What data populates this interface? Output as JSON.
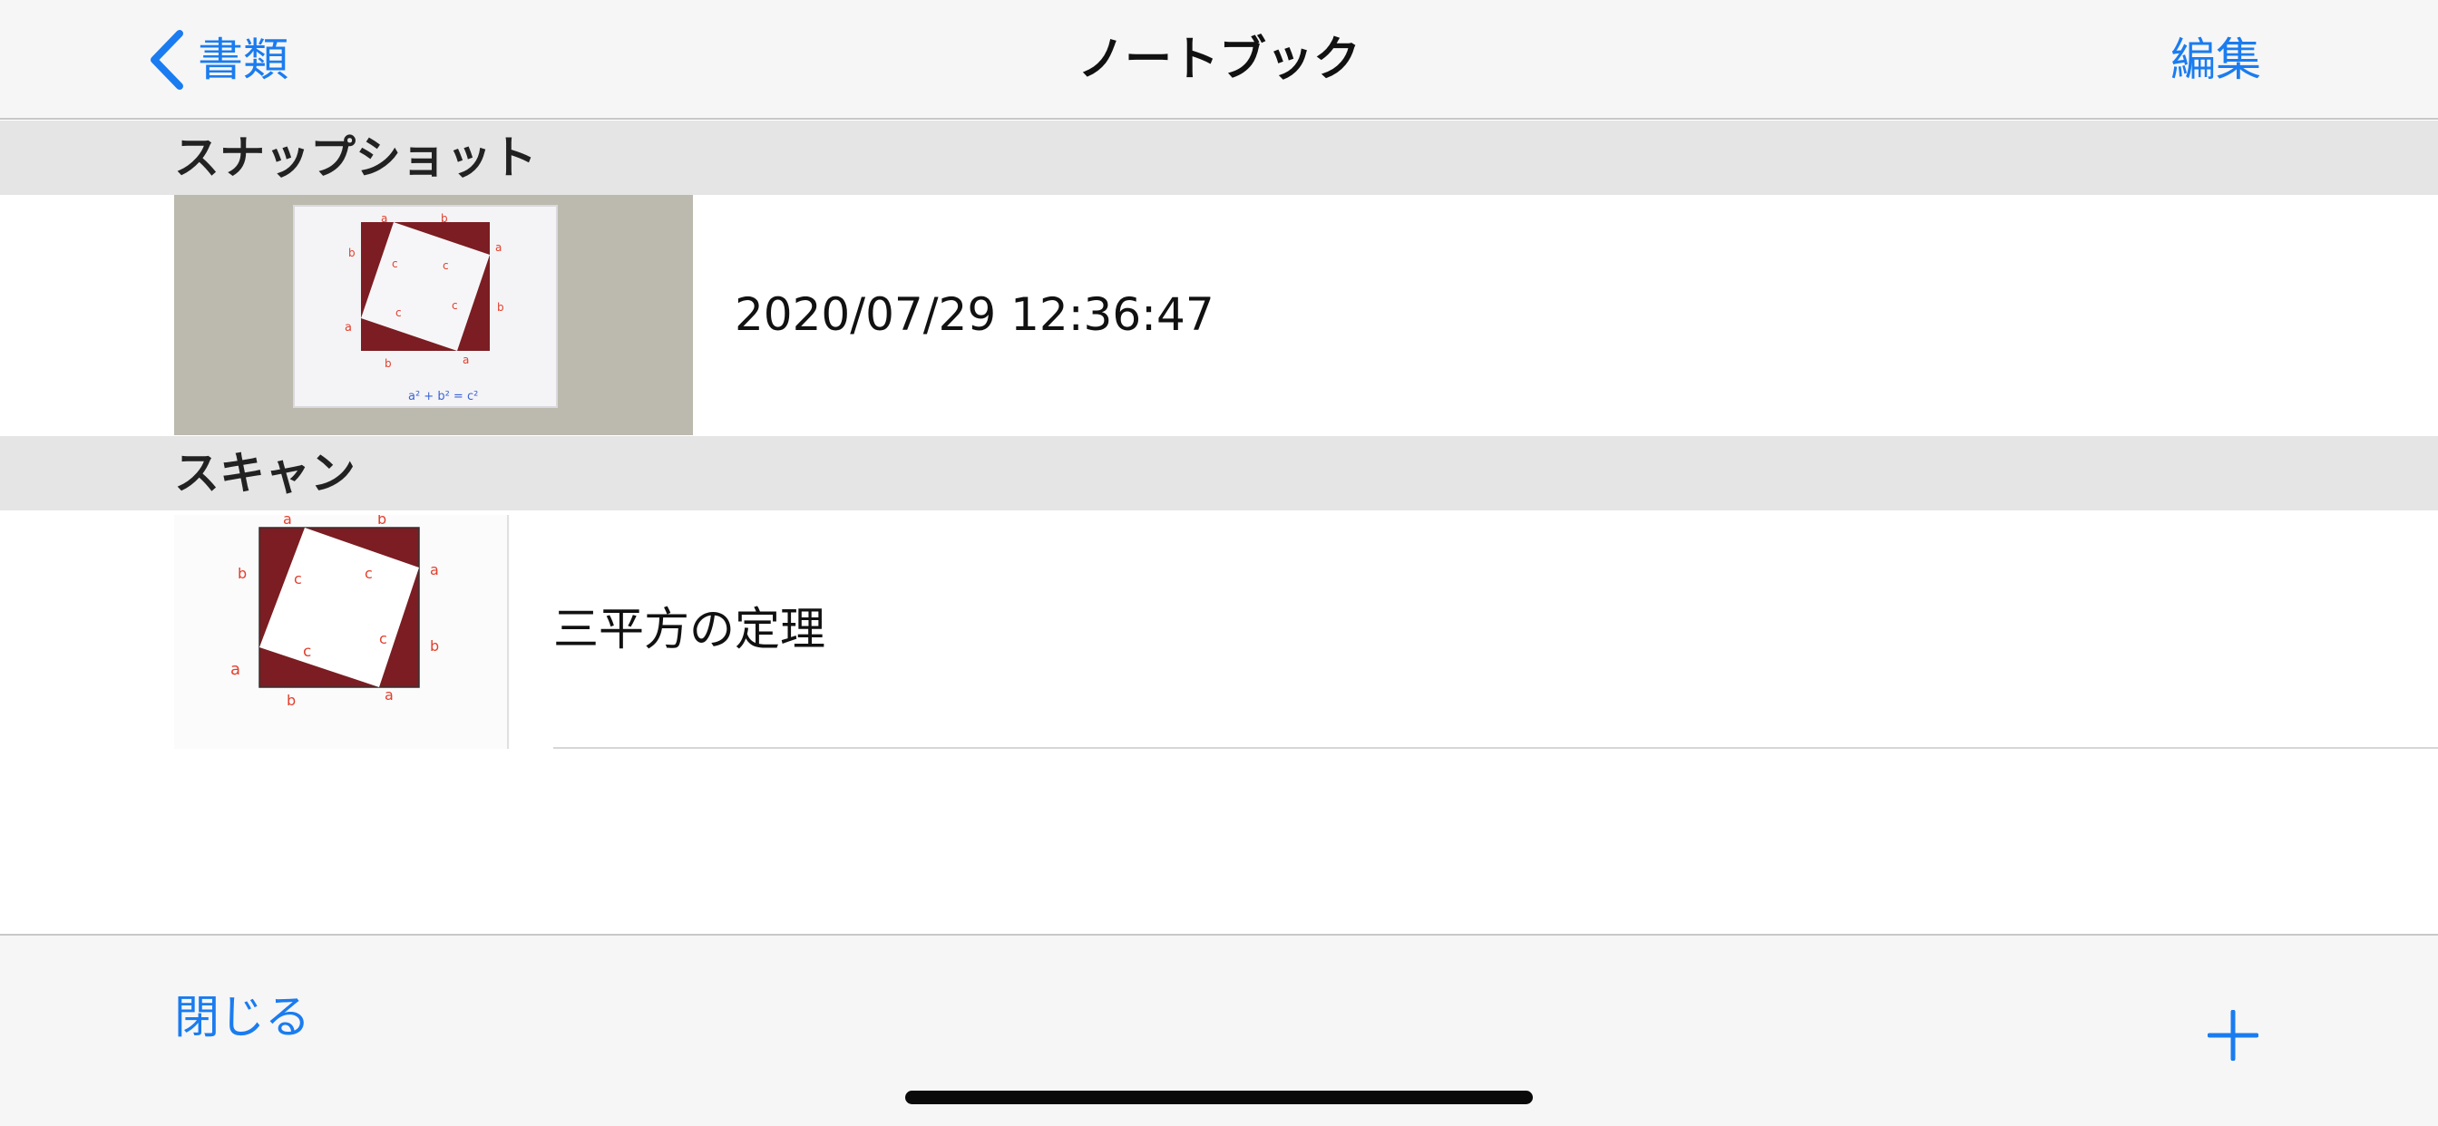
{
  "nav": {
    "back_label": "書類",
    "title": "ノートブック",
    "edit_label": "編集"
  },
  "sections": [
    {
      "header": "スナップショット",
      "rows": [
        {
          "label": "2020/07/29 12:36:47",
          "thumb_caption": "a² + b² = c²"
        }
      ]
    },
    {
      "header": "スキャン",
      "rows": [
        {
          "label": "三平方の定理"
        }
      ]
    }
  ],
  "toolbar": {
    "close_label": "閉じる",
    "add_icon": "plus-icon"
  },
  "colors": {
    "accent": "#1a7cf0",
    "nav_background": "#f6f6f6",
    "section_background": "#e5e5e5",
    "square_fill": "#7b1d22",
    "label_red": "#e2402e"
  }
}
